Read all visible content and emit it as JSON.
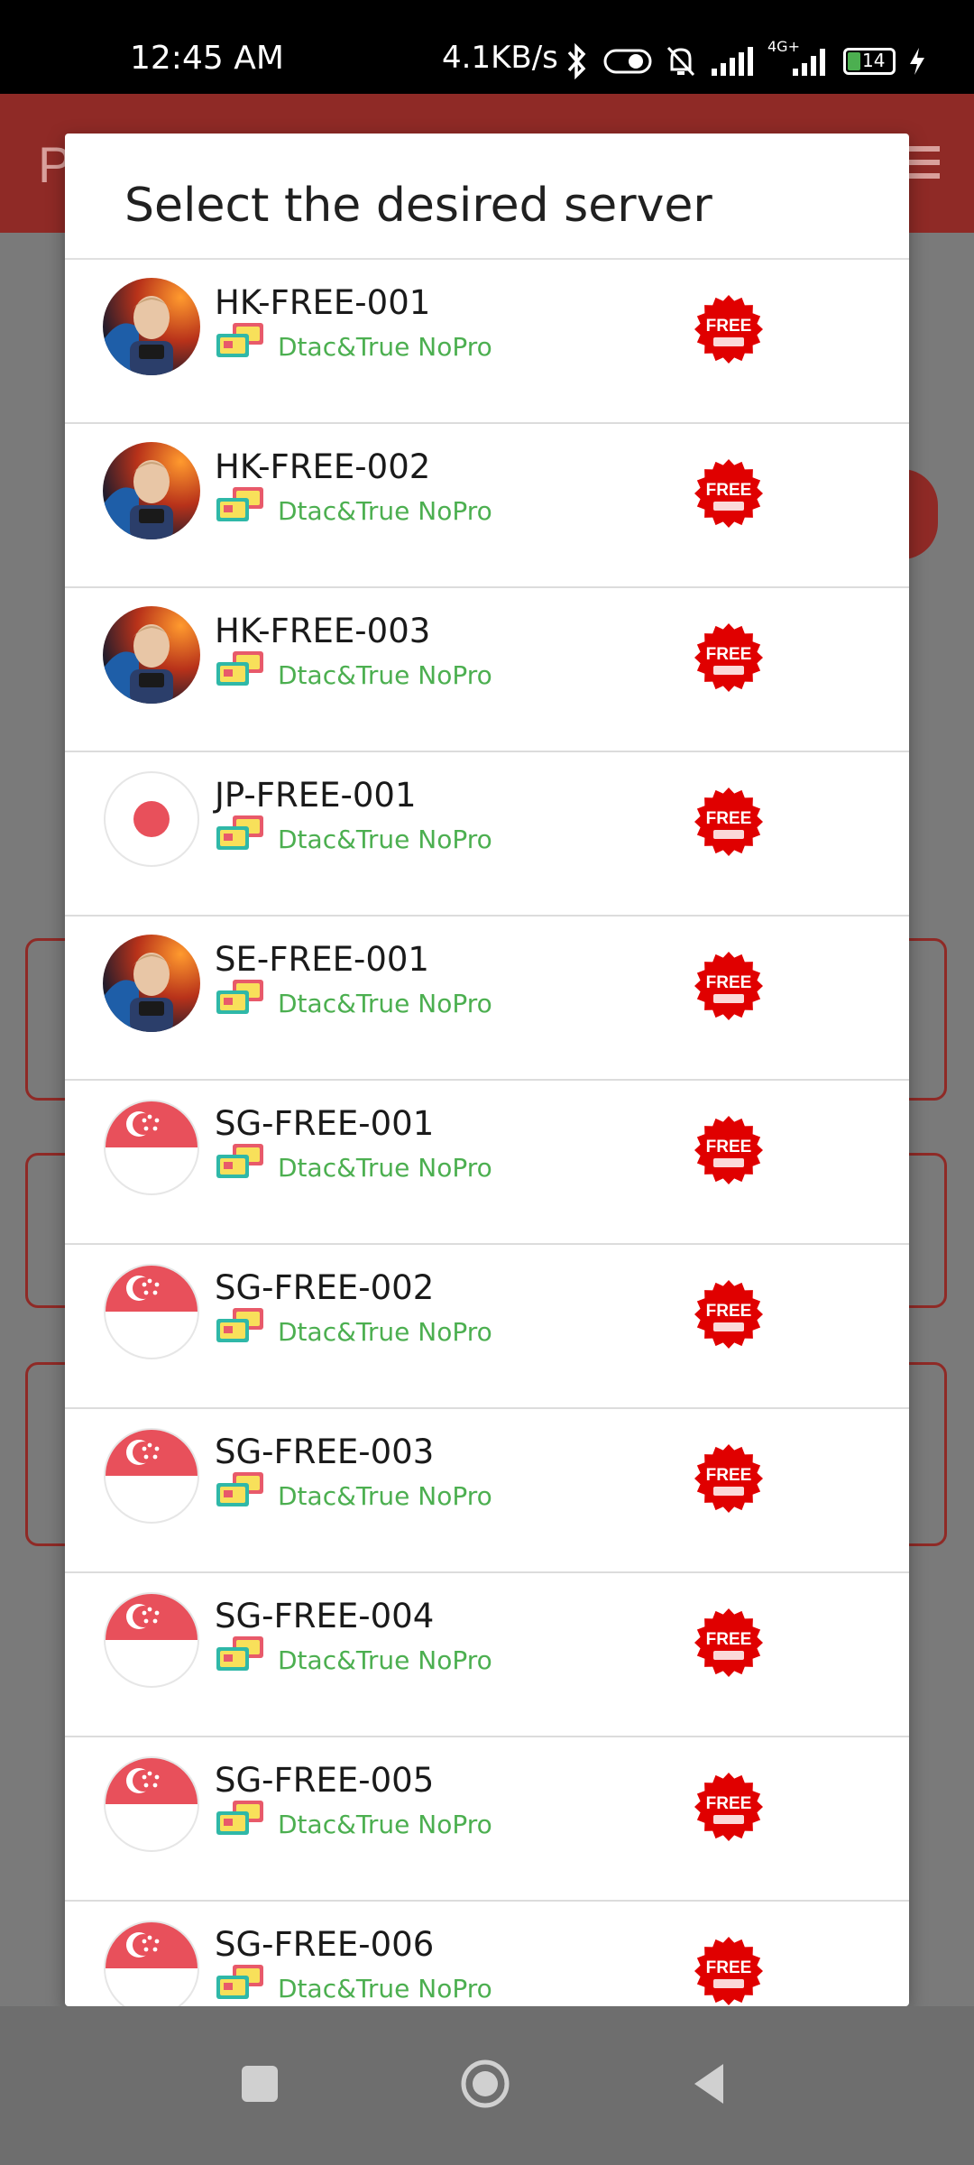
{
  "status_bar": {
    "time": "12:45 AM",
    "network_speed": "4.1KB/s",
    "battery": "14",
    "signal_label": "4G+"
  },
  "background_app": {
    "title_initial": "P"
  },
  "dialog": {
    "title": "Select the desired server"
  },
  "servers": [
    {
      "name": "HK-FREE-001",
      "carrier": "Dtac&True NoPro",
      "flag": "avatar-icon",
      "badge": "FREE"
    },
    {
      "name": "HK-FREE-002",
      "carrier": "Dtac&True NoPro",
      "flag": "avatar-icon",
      "badge": "FREE"
    },
    {
      "name": "HK-FREE-003",
      "carrier": "Dtac&True NoPro",
      "flag": "avatar-icon",
      "badge": "FREE"
    },
    {
      "name": "JP-FREE-001",
      "carrier": "Dtac&True NoPro",
      "flag": "japan-flag-icon",
      "badge": "FREE"
    },
    {
      "name": "SE-FREE-001",
      "carrier": "Dtac&True NoPro",
      "flag": "avatar-icon",
      "badge": "FREE"
    },
    {
      "name": "SG-FREE-001",
      "carrier": "Dtac&True NoPro",
      "flag": "singapore-flag-icon",
      "badge": "FREE"
    },
    {
      "name": "SG-FREE-002",
      "carrier": "Dtac&True NoPro",
      "flag": "singapore-flag-icon",
      "badge": "FREE"
    },
    {
      "name": "SG-FREE-003",
      "carrier": "Dtac&True NoPro",
      "flag": "singapore-flag-icon",
      "badge": "FREE"
    },
    {
      "name": "SG-FREE-004",
      "carrier": "Dtac&True NoPro",
      "flag": "singapore-flag-icon",
      "badge": "FREE"
    },
    {
      "name": "SG-FREE-005",
      "carrier": "Dtac&True NoPro",
      "flag": "singapore-flag-icon",
      "badge": "FREE"
    },
    {
      "name": "SG-FREE-006",
      "carrier": "Dtac&True NoPro",
      "flag": "singapore-flag-icon",
      "badge": "FREE"
    }
  ],
  "colors": {
    "accent": "#d32f2f",
    "carrier_text": "#4caf50",
    "badge_red": "#e00000"
  },
  "nav_bar": {
    "buttons": [
      "recents-button",
      "home-button",
      "back-button"
    ]
  }
}
